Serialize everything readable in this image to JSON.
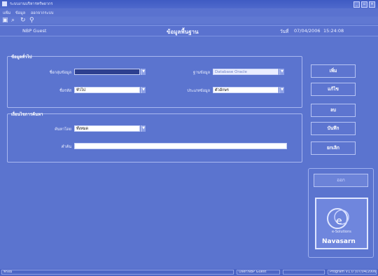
{
  "window": {
    "title": "ระบบงานบริหารทรัพยากร",
    "minimize": "_",
    "maximize": "▫",
    "close": "×"
  },
  "menu": {
    "items": [
      "แฟ้ม",
      "ข้อมูล",
      "ออกจากระบบ"
    ]
  },
  "toolbar": {
    "icons": [
      "window-icon",
      "search-icon",
      "refresh-icon",
      "filter-icon"
    ],
    "glyphs": [
      "▣",
      "⌕",
      "↻",
      "⚲"
    ]
  },
  "info": {
    "user": "NBP Guest",
    "page_title": "ข้อมูลพื้นฐาน",
    "date_label": "วันที่",
    "date_value": "07/04/2006",
    "time_value": "15:24:08"
  },
  "section1": {
    "title": "ข้อมูลทั่วไป",
    "fields": [
      {
        "label": "ชื่อกลุ่มข้อมูล",
        "value": "",
        "style": "selected"
      },
      {
        "label": "ชื่อรหัส",
        "value": "ทั่วไป",
        "style": "normal"
      },
      {
        "label": "ฐานข้อมูล",
        "value": "Database Oracle",
        "style": "disabled"
      },
      {
        "label": "ประเภทข้อมูล",
        "value": "ตัวอักษร",
        "style": "normal"
      }
    ]
  },
  "section2": {
    "title": "เงื่อนไขการค้นหา",
    "fields": [
      {
        "label": "ค้นหาโดย",
        "value": "ทั้งหมด",
        "style": "normal"
      },
      {
        "label": "คำค้น",
        "value": "",
        "style": "normal"
      }
    ]
  },
  "side_buttons": {
    "add": "เพิ่ม",
    "edit": "แก้ไข",
    "delete": "ลบ",
    "save": "บันทึก",
    "cancel": "ยกเลิก",
    "exit": "ออก"
  },
  "logo": {
    "text": "Navasarn",
    "sub": "e-Solutions"
  },
  "status": {
    "left": "พร้อม",
    "user": "User:NBP Guest",
    "program": "Program V1.0 (07/04/2006)"
  },
  "colors": {
    "background": "#5b74cf",
    "accent": "#2d3f8f"
  }
}
